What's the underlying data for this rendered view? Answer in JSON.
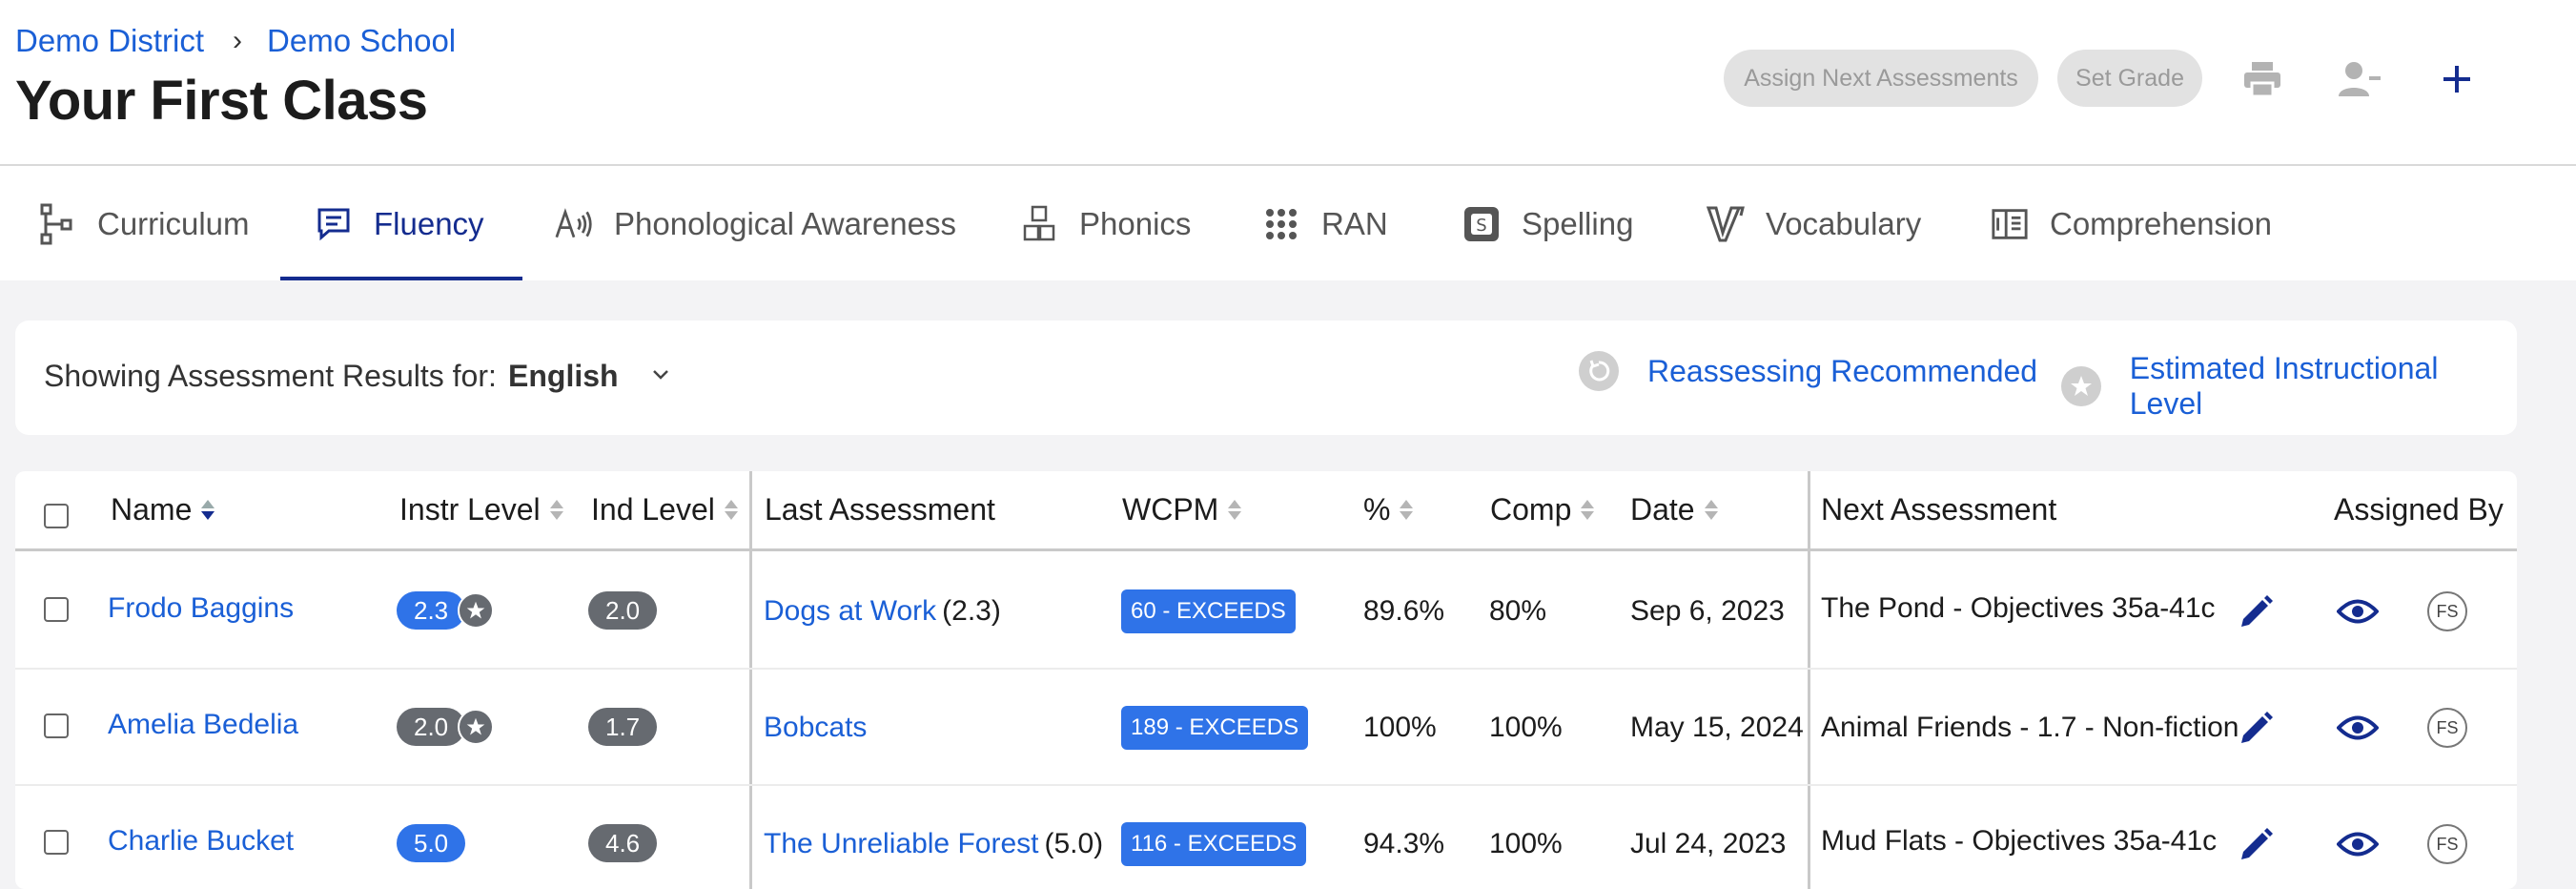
{
  "breadcrumb": {
    "district": "Demo District",
    "separator": "›",
    "school": "Demo School"
  },
  "page_title": "Your First Class",
  "header_actions": {
    "assign_label": "Assign Next Assessments",
    "set_grade_label": "Set Grade",
    "icons": [
      "print-icon",
      "remove-user-icon",
      "plus-icon"
    ]
  },
  "tabs": [
    {
      "label": "Curriculum",
      "icon": "curriculum-icon",
      "active": false
    },
    {
      "label": "Fluency",
      "icon": "fluency-icon",
      "active": true
    },
    {
      "label": "Phonological Awareness",
      "icon": "phonological-icon",
      "active": false
    },
    {
      "label": "Phonics",
      "icon": "phonics-icon",
      "active": false
    },
    {
      "label": "RAN",
      "icon": "ran-icon",
      "active": false
    },
    {
      "label": "Spelling",
      "icon": "spelling-icon",
      "active": false
    },
    {
      "label": "Vocabulary",
      "icon": "vocabulary-icon",
      "active": false
    },
    {
      "label": "Comprehension",
      "icon": "comprehension-icon",
      "active": false
    }
  ],
  "filter": {
    "label": "Showing Assessment Results for:",
    "language": "English",
    "legend_reassess": "Reassessing Recommended",
    "legend_eil": "Estimated Instructional Level"
  },
  "table": {
    "headers": {
      "name": "Name",
      "instr_level": "Instr Level",
      "ind_level": "Ind Level",
      "last_assessment": "Last Assessment",
      "wcpm": "WCPM",
      "pct": "%",
      "comp": "Comp",
      "date": "Date",
      "next_assessment": "Next Assessment",
      "assigned_by": "Assigned By"
    },
    "rows": [
      {
        "name": "Frodo Baggins",
        "instr_level": "2.3",
        "instr_star": true,
        "ind_level": "2.0",
        "last_assessment": "Dogs at Work",
        "last_level": "(2.3)",
        "wcpm": "60 - EXCEEDS",
        "pct": "89.6%",
        "comp": "80%",
        "date": "Sep 6, 2023",
        "next_assessment": "The Pond - Objectives 35a-41c",
        "assigned_by": "FS"
      },
      {
        "name": "Amelia Bedelia",
        "instr_level": "2.0",
        "instr_star": true,
        "ind_level": "1.7",
        "last_assessment": "Bobcats",
        "last_level": "",
        "wcpm": "189 - EXCEEDS",
        "pct": "100%",
        "comp": "100%",
        "date": "May 15, 2024",
        "next_assessment": "Animal Friends - 1.7 - Non-fiction",
        "assigned_by": "FS"
      },
      {
        "name": "Charlie Bucket",
        "instr_level": "5.0",
        "instr_star": false,
        "ind_level": "4.6",
        "last_assessment": "The Unreliable Forest",
        "last_level": "(5.0)",
        "wcpm": "116 - EXCEEDS",
        "pct": "94.3%",
        "comp": "100%",
        "date": "Jul 24, 2023",
        "next_assessment": "Mud Flats - Objectives 35a-41c",
        "assigned_by": "FS"
      }
    ]
  },
  "colors": {
    "link": "#1a5fd6",
    "accent": "#142c8f",
    "badge_blue": "#2f73e8",
    "badge_gray": "#666a70"
  }
}
